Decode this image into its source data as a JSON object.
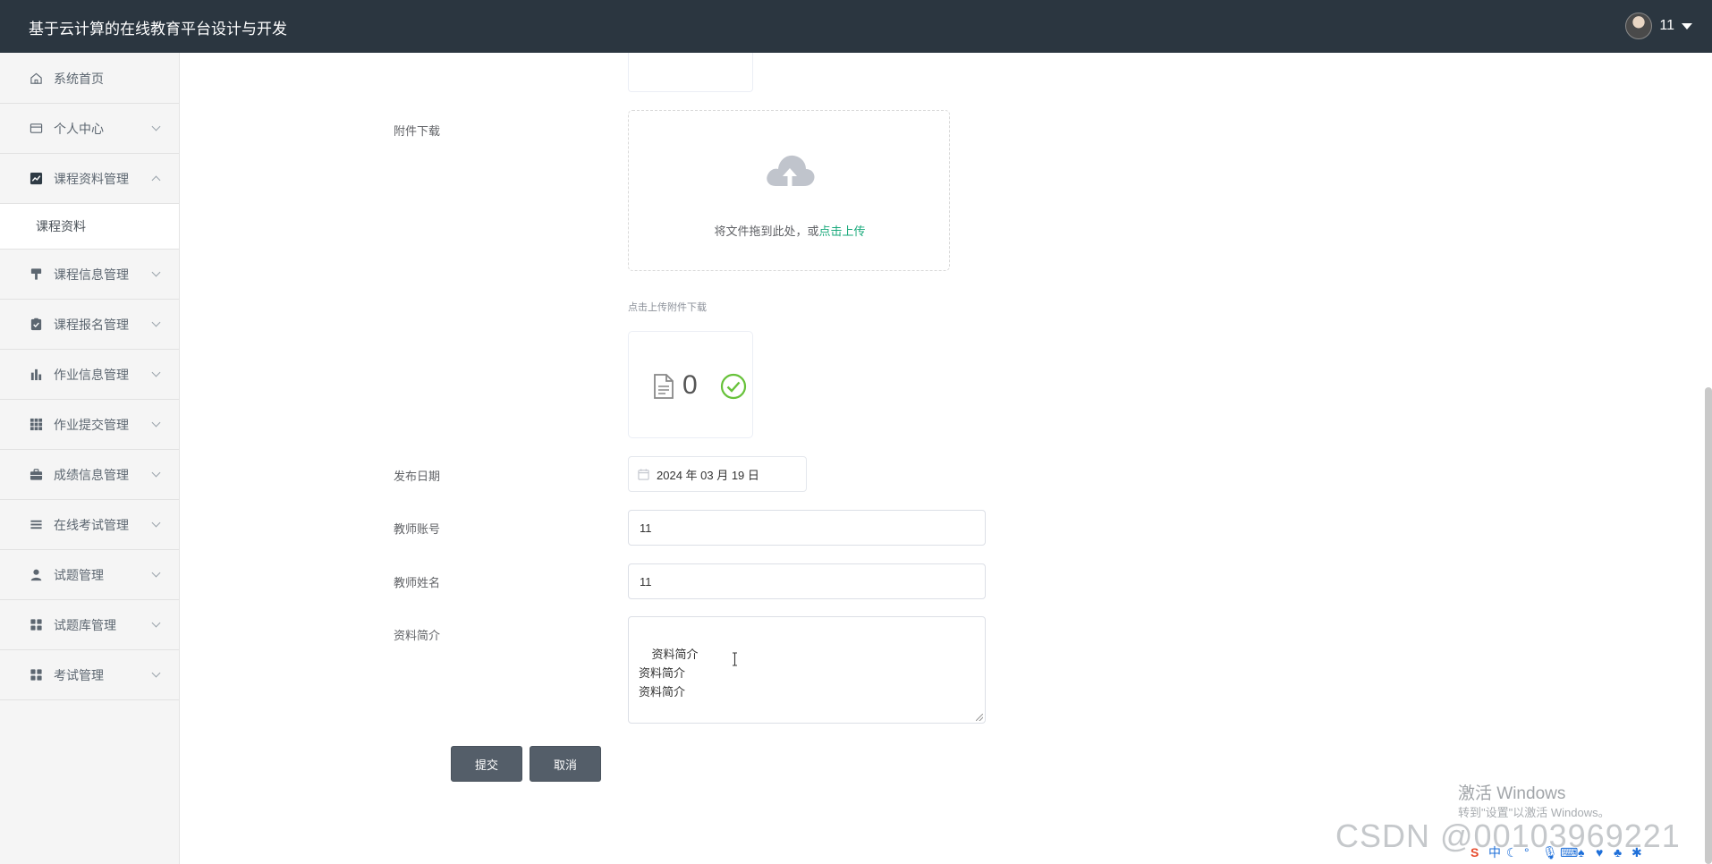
{
  "header": {
    "app_title": "基于云计算的在线教育平台设计与开发",
    "user_name": "11"
  },
  "sidebar": {
    "items": [
      {
        "label": "系统首页",
        "icon": "home-icon",
        "expandable": false
      },
      {
        "label": "个人中心",
        "icon": "card-icon",
        "expandable": true
      },
      {
        "label": "课程资料管理",
        "icon": "chart-line-icon",
        "expandable": true,
        "expanded": true
      },
      {
        "label": "课程信息管理",
        "icon": "brush-icon",
        "expandable": true
      },
      {
        "label": "课程报名管理",
        "icon": "clipboard-check-icon",
        "expandable": true
      },
      {
        "label": "作业信息管理",
        "icon": "bar-chart-icon",
        "expandable": true
      },
      {
        "label": "作业提交管理",
        "icon": "grid-icon",
        "expandable": true
      },
      {
        "label": "成绩信息管理",
        "icon": "briefcase-icon",
        "expandable": true
      },
      {
        "label": "在线考试管理",
        "icon": "list-icon",
        "expandable": true
      },
      {
        "label": "试题管理",
        "icon": "user-icon",
        "expandable": true
      },
      {
        "label": "试题库管理",
        "icon": "apps-icon",
        "expandable": true
      },
      {
        "label": "考试管理",
        "icon": "apps-icon",
        "expandable": true
      }
    ],
    "submenu": {
      "label": "课程资料"
    }
  },
  "form": {
    "attachment_label": "附件下载",
    "upload_text": "将文件拖到此处，或",
    "upload_link": "点击上传",
    "upload_tip": "点击上传附件下载",
    "file_count": "0",
    "date_label": "发布日期",
    "date_value": "2024 年 03 月 19 日",
    "teacher_account_label": "教师账号",
    "teacher_account_value": "11",
    "teacher_name_label": "教师姓名",
    "teacher_name_value": "11",
    "intro_label": "资料简介",
    "intro_value": "资料简介\n资料简介\n资料简介\n",
    "submit_label": "提交",
    "cancel_label": "取消"
  },
  "overlay": {
    "activate_title": "激活 Windows",
    "activate_sub": "转到\"设置\"以激活 Windows。",
    "csdn_watermark": "CSDN @00103969221"
  },
  "colors": {
    "topbar": "#2b3640",
    "button": "#545e69",
    "link": "#19a97b",
    "success": "#67c23a"
  }
}
